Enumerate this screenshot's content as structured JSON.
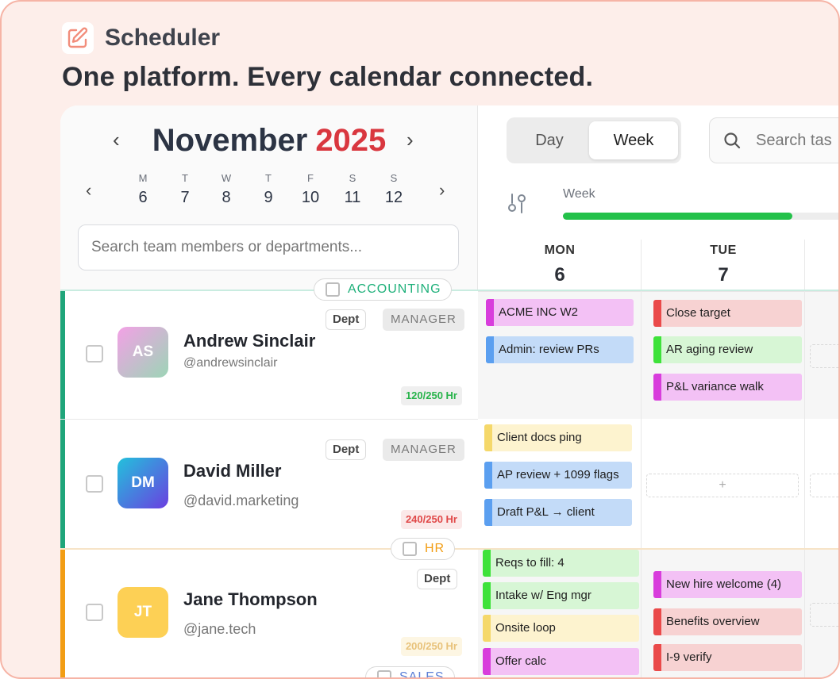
{
  "brand": {
    "name": "Scheduler",
    "tagline": "One platform. Every calendar connected.",
    "icon": "edit-icon"
  },
  "calendar": {
    "month": "November",
    "year": "2025",
    "days": [
      {
        "letter": "M",
        "num": "6"
      },
      {
        "letter": "T",
        "num": "7"
      },
      {
        "letter": "W",
        "num": "8"
      },
      {
        "letter": "T",
        "num": "9"
      },
      {
        "letter": "F",
        "num": "10"
      },
      {
        "letter": "S",
        "num": "11"
      },
      {
        "letter": "S",
        "num": "12"
      }
    ],
    "member_search_placeholder": "Search team members or departments..."
  },
  "view": {
    "day_label": "Day",
    "week_label": "Week",
    "selected": "Week"
  },
  "task_search": {
    "placeholder": "Search tas"
  },
  "progress": {
    "label": "Week",
    "fraction": 0.78,
    "color": "#24c14a"
  },
  "columns": [
    {
      "day": "MON",
      "num": "6"
    },
    {
      "day": "TUE",
      "num": "7"
    }
  ],
  "groups": {
    "accounting": {
      "label": "ACCOUNTING",
      "color": "#1fb07a"
    },
    "hr": {
      "label": "HR",
      "color": "#f29d14"
    },
    "sales": {
      "label": "SALES"
    }
  },
  "members": [
    {
      "initials": "AS",
      "name": "Andrew Sinclair",
      "handle": "@andrewsinclair",
      "dept_tag": "Dept",
      "role_tag": "MANAGER",
      "hours": "120/250 Hr",
      "hours_color": "#27b34a",
      "mon_tasks": [
        {
          "label": "ACME INC W2",
          "color": "pink"
        },
        {
          "label": "Admin: review PRs",
          "color": "blue"
        }
      ],
      "tue_tasks": [
        {
          "label": "Close target",
          "color": "red"
        },
        {
          "label": "AR aging review",
          "color": "green"
        },
        {
          "label": "P&L variance walk",
          "color": "pink"
        }
      ]
    },
    {
      "initials": "DM",
      "name": "David Miller",
      "handle": "@david.marketing",
      "dept_tag": "Dept",
      "role_tag": "MANAGER",
      "hours": "240/250 Hr",
      "hours_color": "#e04848",
      "mon_tasks": [
        {
          "label": "Client docs ping",
          "color": "yellow"
        },
        {
          "label": "AP review + 1099 flags",
          "color": "blue"
        },
        {
          "label": "Draft P&L → client",
          "color": "blue"
        }
      ],
      "tue_tasks": [],
      "tue_empty": "+"
    },
    {
      "initials": "JT",
      "name": "Jane Thompson",
      "handle": "@jane.tech",
      "dept_tag": "Dept",
      "hours": "200/250 Hr",
      "hours_color": "#e8c27a",
      "mon_tasks": [
        {
          "label": "Reqs to fill: 4",
          "color": "green"
        },
        {
          "label": "Intake w/ Eng mgr",
          "color": "green"
        },
        {
          "label": "Onsite loop",
          "color": "yellow"
        },
        {
          "label": "Offer calc",
          "color": "pink"
        }
      ],
      "tue_tasks": [
        {
          "label": "New hire welcome (4)",
          "color": "pink"
        },
        {
          "label": "Benefits overview",
          "color": "red"
        },
        {
          "label": "I-9 verify",
          "color": "red"
        }
      ]
    }
  ]
}
